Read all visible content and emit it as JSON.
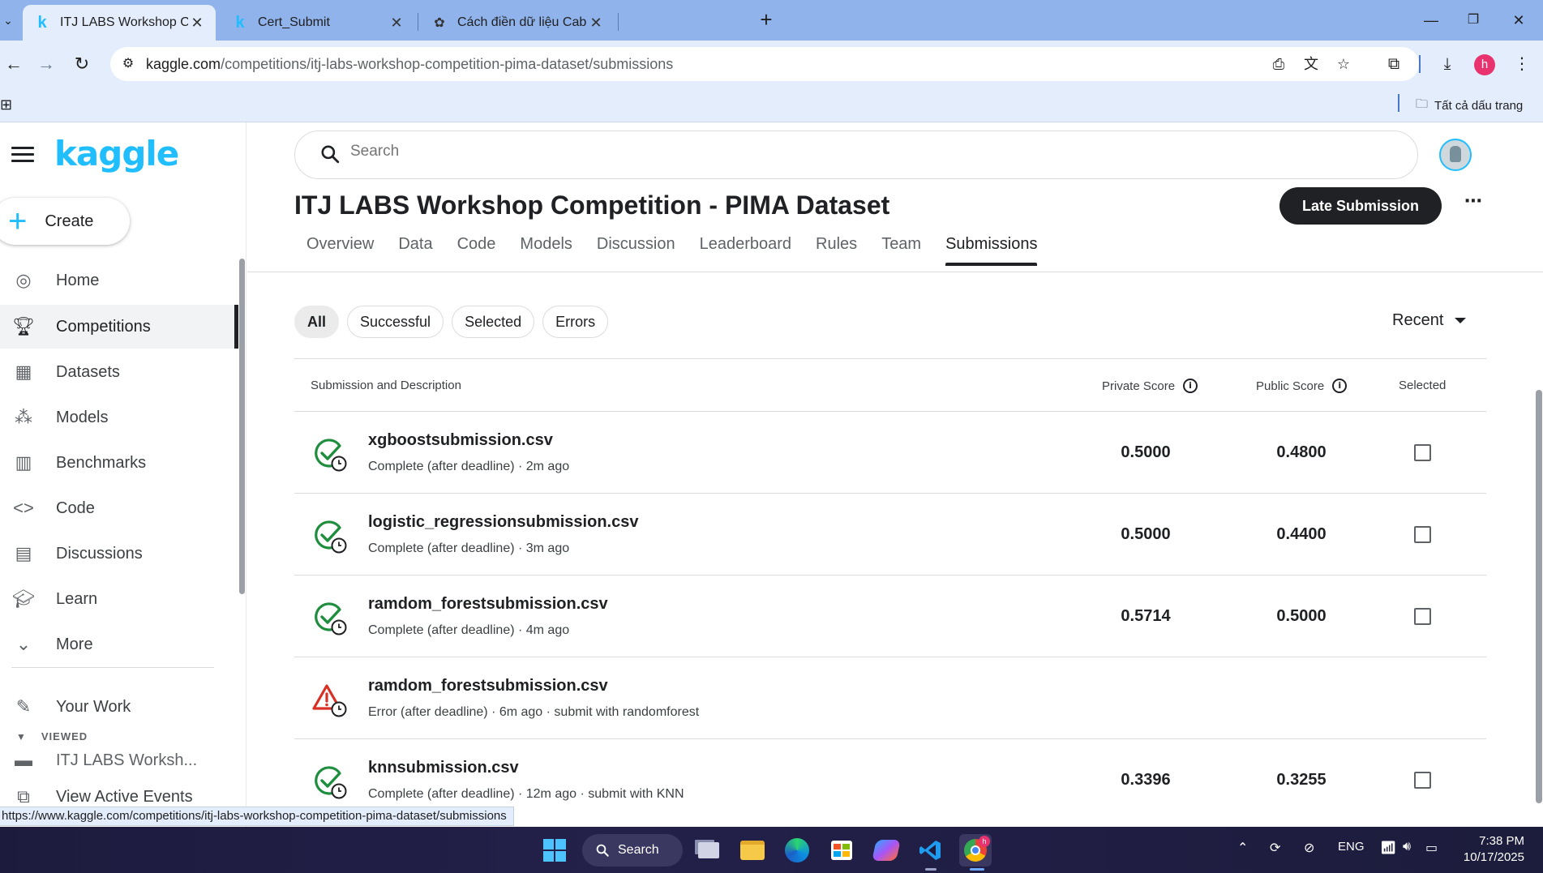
{
  "browser": {
    "tabs": [
      {
        "title": "ITJ LABS Workshop Competition - PIMA Dataset",
        "favicon": "kaggle-k",
        "active": true
      },
      {
        "title": "Cert_Submit",
        "favicon": "kaggle-k",
        "active": false
      },
      {
        "title": "Cách điền dữ liệu Cabin",
        "favicon": "chatgpt-icon",
        "active": false
      }
    ],
    "url_host": "kaggle.com",
    "url_path": "/competitions/itj-labs-workshop-competition-pima-dataset/submissions",
    "profile_initial": "h",
    "bookmarks_all": "Tất cả dấu trang",
    "status_url": "https://www.kaggle.com/competitions/itj-labs-workshop-competition-pima-dataset/submissions"
  },
  "kaggle": {
    "logo": "kaggle",
    "create_label": "Create",
    "search_placeholder": "Search",
    "nav": [
      {
        "label": "Home",
        "icon": "compass-icon"
      },
      {
        "label": "Competitions",
        "icon": "trophy-icon",
        "active": true
      },
      {
        "label": "Datasets",
        "icon": "table-icon"
      },
      {
        "label": "Models",
        "icon": "models-icon"
      },
      {
        "label": "Benchmarks",
        "icon": "bar-chart-icon"
      },
      {
        "label": "Code",
        "icon": "code-icon"
      },
      {
        "label": "Discussions",
        "icon": "comment-icon"
      },
      {
        "label": "Learn",
        "icon": "graduation-cap-icon"
      },
      {
        "label": "More",
        "icon": "chevron-down-icon"
      }
    ],
    "your_work": "Your Work",
    "viewed_label": "VIEWED",
    "viewed_item": "ITJ LABS Worksh...",
    "active_events": "View Active Events"
  },
  "competition": {
    "title": "ITJ LABS Workshop Competition - PIMA Dataset",
    "late_submission_label": "Late Submission",
    "tabs": [
      "Overview",
      "Data",
      "Code",
      "Models",
      "Discussion",
      "Leaderboard",
      "Rules",
      "Team",
      "Submissions"
    ],
    "active_tab": "Submissions",
    "filters": [
      "All",
      "Successful",
      "Selected",
      "Errors"
    ],
    "active_filter": "All",
    "sort": "Recent",
    "columns": {
      "submission": "Submission and Description",
      "private": "Private Score",
      "public": "Public Score",
      "selected": "Selected"
    },
    "submissions": [
      {
        "file": "xgboostsubmission.csv",
        "desc": "Complete (after deadline) · 2m ago",
        "private": "0.5000",
        "public": "0.4800",
        "status": "complete"
      },
      {
        "file": "logistic_regressionsubmission.csv",
        "desc": "Complete (after deadline) · 3m ago",
        "private": "0.5000",
        "public": "0.4400",
        "status": "complete"
      },
      {
        "file": "ramdom_forestsubmission.csv",
        "desc": "Complete (after deadline) · 4m ago",
        "private": "0.5714",
        "public": "0.5000",
        "status": "complete"
      },
      {
        "file": "ramdom_forestsubmission.csv",
        "desc": "Error (after deadline) · 6m ago · submit with randomforest",
        "private": "",
        "public": "",
        "status": "error"
      },
      {
        "file": "knnsubmission.csv",
        "desc": "Complete (after deadline) · 12m ago · submit with KNN",
        "private": "0.3396",
        "public": "0.3255",
        "status": "complete"
      }
    ]
  },
  "taskbar": {
    "search_label": "Search",
    "language": "ENG",
    "time": "7:38 PM",
    "date": "10/17/2025"
  },
  "colors": {
    "kaggle_blue": "#20beff",
    "complete_green": "#1e8e3e",
    "error_red": "#d93025",
    "chrome_frame": "#8fb3ea",
    "chrome_toolbar": "#e3edfc"
  }
}
